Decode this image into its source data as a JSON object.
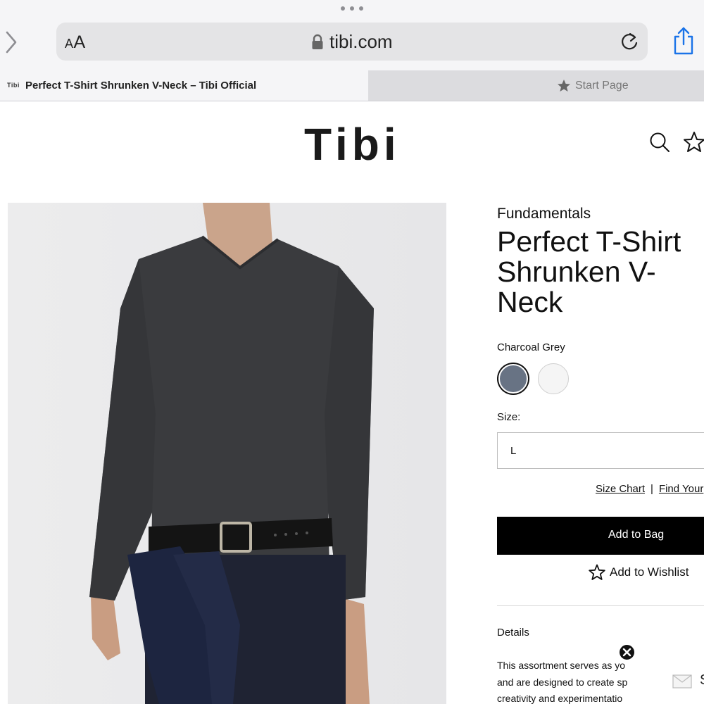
{
  "browser": {
    "reader_label_small": "A",
    "reader_label_large": "A",
    "url": "tibi.com"
  },
  "tabs": [
    {
      "favicon_text": "Tibi",
      "title": "Perfect T-Shirt Shrunken V-Neck – Tibi Official",
      "active": true
    },
    {
      "title": "Start Page",
      "active": false
    }
  ],
  "site": {
    "logo": "Tibi"
  },
  "product": {
    "collection": "Fundamentals",
    "title": "Perfect T-Shirt Shrunken V-Neck",
    "color_label": "Charcoal Grey",
    "swatches": [
      {
        "name": "Charcoal Grey",
        "color": "#687384",
        "selected": true
      },
      {
        "name": "White",
        "color": "#f5f5f5",
        "selected": false
      }
    ],
    "size_label": "Size:",
    "size_value": "L",
    "size_chart_link": "Size Chart",
    "separator": "|",
    "find_size_link": "Find Your",
    "add_to_bag": "Add to Bag",
    "add_to_wishlist": "Add to Wishlist",
    "details_heading": "Details",
    "description_lines": [
      "This assortment serves as yo",
      "and are designed to create sp",
      "creativity and experimentatio"
    ]
  },
  "overlay": {
    "partial_text": "S"
  },
  "colors": {
    "accent": "#000000",
    "swatch_charcoal": "#687384",
    "chrome_bg": "#f5f5f7"
  }
}
